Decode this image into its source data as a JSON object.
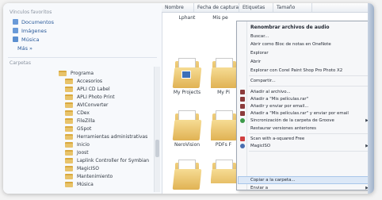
{
  "nav": {
    "favorites_header": "Vínculos favoritos",
    "favorites": [
      {
        "label": "Documentos",
        "icon": "documents-icon"
      },
      {
        "label": "Imágenes",
        "icon": "pictures-icon"
      },
      {
        "label": "Música",
        "icon": "music-icon"
      },
      {
        "label": "Más »",
        "icon": ""
      }
    ],
    "folders_header": "Carpetas",
    "tree_parent": "Programa",
    "tree": [
      "Accesorios",
      "APLI CD Label",
      "APLI Photo Print",
      "AVIConverter",
      "CDex",
      "FileZilla",
      "GSpot",
      "Herramientas administrativas",
      "Inicio",
      "Joost",
      "Laplink Controller for Symbian",
      "MagicISO",
      "Mantenimiento",
      "Música"
    ]
  },
  "columns": [
    "Nombre",
    "Fecha de captura",
    "Etiquetas",
    "Tamaño"
  ],
  "tiles": [
    {
      "label": "Lphant",
      "badge": false
    },
    {
      "label": "Mis pe",
      "badge": false
    },
    {
      "label": "",
      "badge": false
    },
    {
      "label": "My Projects",
      "badge": true
    },
    {
      "label": "My Pi",
      "badge": false
    },
    {
      "label": "",
      "badge": false
    },
    {
      "label": "NeroVision",
      "badge": false
    },
    {
      "label": "PDFs F",
      "badge": false
    }
  ],
  "menu": {
    "items": [
      {
        "label": "Renombrar archivos de audio",
        "bold": true
      },
      {
        "label": "Buscar..."
      },
      {
        "label": "Abrir como Bloc de notas en OneNote"
      },
      {
        "label": "Explorar"
      },
      {
        "label": "Abrir"
      },
      {
        "label": "Explorar con Corel Paint Shop Pro Photo X2"
      },
      {
        "label": "Compartir..."
      },
      {
        "label": "Añadir al archivo...",
        "icon": true
      },
      {
        "label": "Añadir a \"Mis películas.rar\"",
        "icon": true
      },
      {
        "label": "Añadir y enviar por email...",
        "icon": true
      },
      {
        "label": "Añadir a \"Mis películas.rar\" y enviar por email",
        "icon": true
      },
      {
        "label": "Sincronización de la carpeta de Groove",
        "icon": true,
        "submenu": true
      },
      {
        "label": "Restaurar versiones anteriores"
      },
      {
        "label": "Scan with a-squared Free",
        "icon": true
      },
      {
        "label": "MagicISO",
        "icon": true,
        "submenu": true
      },
      {
        "label": "Copiar a la carpeta...",
        "highlight": true
      },
      {
        "label": "Enviar a",
        "submenu": true
      }
    ]
  },
  "colors": {
    "menu_highlight": "#dce8f7",
    "folder": "#e8c36a",
    "link_blue": "#2a5a9a"
  }
}
